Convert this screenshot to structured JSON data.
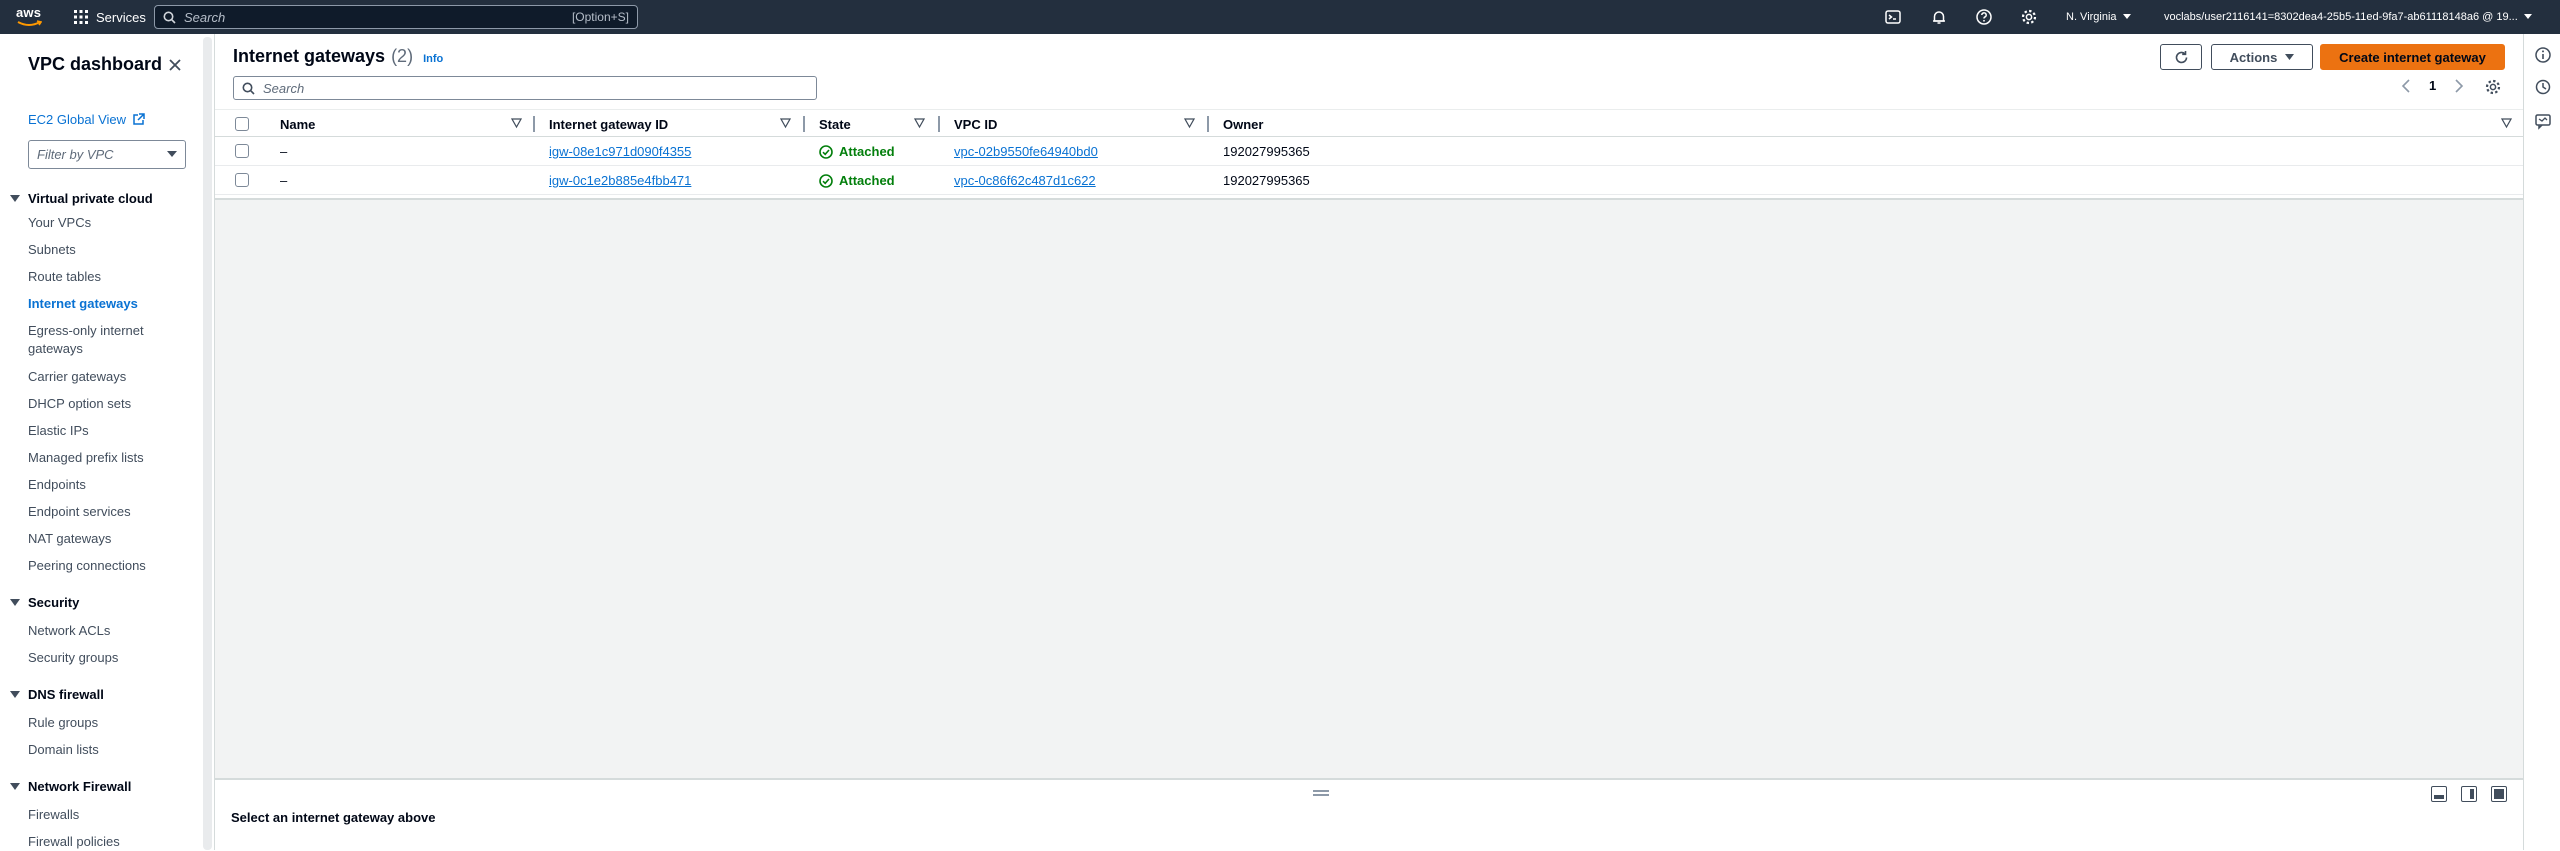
{
  "topnav": {
    "logo_text": "aws",
    "services_label": "Services",
    "search_placeholder": "Search",
    "search_shortcut": "[Option+S]",
    "region": "N. Virginia",
    "account": "voclabs/user2116141=8302dea4-25b5-11ed-9fa7-ab61118148a6 @ 19..."
  },
  "sidebar": {
    "title": "VPC dashboard",
    "ec2_global_view": "EC2 Global View",
    "filter_placeholder": "Filter by VPC",
    "sections": [
      {
        "title": "Virtual private cloud",
        "items": [
          "Your VPCs",
          "Subnets",
          "Route tables",
          "Internet gateways",
          "Egress-only internet",
          "gateways",
          "Carrier gateways",
          "DHCP option sets",
          "Elastic IPs",
          "Managed prefix lists",
          "Endpoints",
          "Endpoint services",
          "NAT gateways",
          "Peering connections"
        ]
      },
      {
        "title": "Security",
        "items": [
          "Network ACLs",
          "Security groups"
        ]
      },
      {
        "title": "DNS firewall",
        "items": [
          "Rule groups",
          "Domain lists"
        ]
      },
      {
        "title": "Network Firewall",
        "items": [
          "Firewalls",
          "Firewall policies"
        ]
      }
    ]
  },
  "main": {
    "title": "Internet gateways",
    "count": "(2)",
    "info": "Info",
    "actions_label": "Actions",
    "create_label": "Create internet gateway",
    "search_placeholder": "Search",
    "page_number": "1",
    "columns": [
      "Name",
      "Internet gateway ID",
      "State",
      "VPC ID",
      "Owner"
    ],
    "rows": [
      {
        "name": "–",
        "igw_id": "igw-08e1c971d090f4355",
        "state": "Attached",
        "vpc_id": "vpc-02b9550fe64940bd0",
        "owner": "192027995365"
      },
      {
        "name": "–",
        "igw_id": "igw-0c1e2b885e4fbb471",
        "state": "Attached",
        "vpc_id": "vpc-0c86f62c487d1c622",
        "owner": "192027995365"
      }
    ],
    "detail_placeholder": "Select an internet gateway above"
  },
  "colors": {
    "topnav_bg": "#232f3e",
    "link": "#0972d3",
    "primary_button": "#ec7211",
    "success": "#037f0c"
  }
}
